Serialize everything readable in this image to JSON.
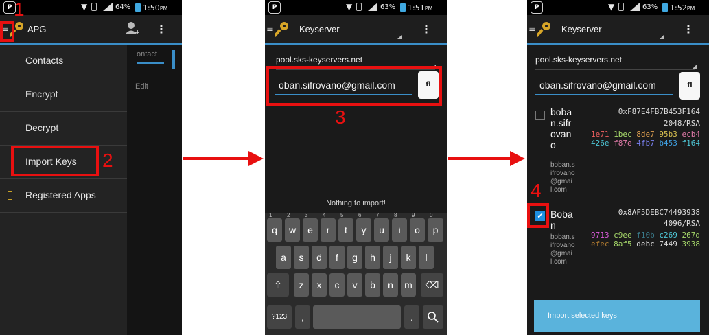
{
  "screen1": {
    "status": {
      "battery": "64%",
      "time": "1:50",
      "time_suffix": "PM"
    },
    "app_title": "APG",
    "drawer_items": [
      {
        "label": "Contacts",
        "icon": "none"
      },
      {
        "label": "Encrypt",
        "icon": "none"
      },
      {
        "label": "Decrypt",
        "icon": "lock-icon"
      },
      {
        "label": "Import Keys",
        "icon": "none"
      },
      {
        "label": "Registered Apps",
        "icon": "lock-icon"
      }
    ],
    "behind_text": [
      "ontact",
      "Edit"
    ],
    "step_labels": [
      "1",
      "2"
    ]
  },
  "screen2": {
    "status": {
      "battery": "63%",
      "time": "1:51",
      "time_suffix": "PM"
    },
    "title": "Keyserver",
    "keyserver": "pool.sks-keyservers.net",
    "query": "oban.sifrovano@gmail.com",
    "search_glyph": "fl",
    "empty_text": "Nothing to import!",
    "step_label": "3",
    "keyboard": {
      "row1": [
        "q",
        "w",
        "e",
        "r",
        "t",
        "y",
        "u",
        "i",
        "o",
        "p"
      ],
      "row1_hints": [
        "1",
        "2",
        "3",
        "4",
        "5",
        "6",
        "7",
        "8",
        "9",
        "0"
      ],
      "row2": [
        "a",
        "s",
        "d",
        "f",
        "g",
        "h",
        "j",
        "k",
        "l"
      ],
      "row3": [
        "z",
        "x",
        "c",
        "v",
        "b",
        "n",
        "m"
      ],
      "shift": "⇧",
      "backspace": "⌫",
      "numbers": "?123",
      "comma": ",",
      "period": ".",
      "search": "🔍"
    }
  },
  "screen3": {
    "status": {
      "battery": "63%",
      "time": "1:52",
      "time_suffix": "PM"
    },
    "title": "Keyserver",
    "keyserver": "pool.sks-keyservers.net",
    "query": "oban.sifrovano@gmail.com",
    "search_glyph": "fl",
    "step_label": "4",
    "results": [
      {
        "name": "boban.sifrovano",
        "email": "boban.sifrovano@gmail.com",
        "key_id": "0xF87E4FB7B453F164",
        "algo": "2048/RSA",
        "fingerprint": [
          [
            "1e71",
            "#f06060"
          ],
          [
            "1bec",
            "#a6d86a"
          ],
          [
            "8de7",
            "#e0a050"
          ],
          [
            "95b3",
            "#d8c050"
          ],
          [
            "ecb4",
            "#e07aa8"
          ],
          [
            "426e",
            "#4ec8d8"
          ],
          [
            "f87e",
            "#e07aa8"
          ],
          [
            "4fb7",
            "#7a80f0"
          ],
          [
            "b453",
            "#3f9fe0"
          ],
          [
            "f164",
            "#4ec8d8"
          ]
        ],
        "checked": false
      },
      {
        "name": "Boban",
        "email": "boban.sifrovano@gmail.com",
        "key_id": "0x8AF5DEBC74493938",
        "algo": "4096/RSA",
        "fingerprint": [
          [
            "9713",
            "#d85ad8"
          ],
          [
            "c9ee",
            "#a6d86a"
          ],
          [
            "f10b",
            "#3a7a8a"
          ],
          [
            "c269",
            "#4ec8d8"
          ],
          [
            "267d",
            "#a6d86a"
          ],
          [
            "efec",
            "#b07a30"
          ],
          [
            "8af5",
            "#a6d86a"
          ],
          [
            "debc",
            "#d8d8d8"
          ],
          [
            "7449",
            "#d8d8d8"
          ],
          [
            "3938",
            "#a6d86a"
          ]
        ],
        "checked": true
      }
    ],
    "import_button": "Import selected keys"
  }
}
